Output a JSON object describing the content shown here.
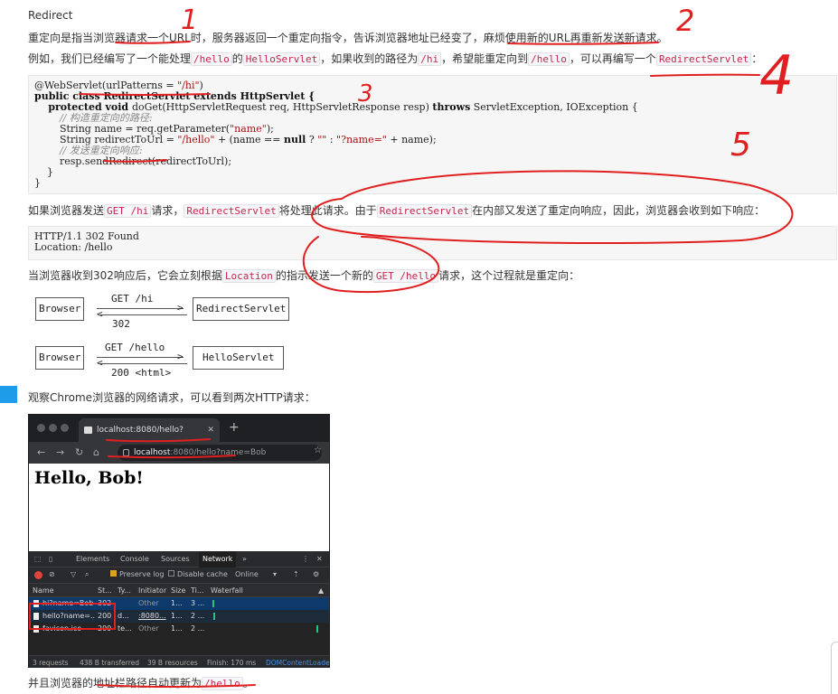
{
  "title": "Redirect",
  "intro": "重定向是指当浏览器请求一个URL时，服务器返回一个重定向指令，告诉浏览器地址已经变了，麻烦使用新的URL再重新发送新请求。",
  "example": {
    "t1": "例如，我们已经编写了一个能处理",
    "c1": "/hello",
    "t2": "的",
    "c2": "HelloServlet",
    "t3": "，如果收到的路径为",
    "c3": "/hi",
    "t4": "，希望能重定向到",
    "c4": "/hello",
    "t5": "，可以再编写一个",
    "c5": "RedirectServlet",
    "t6": "："
  },
  "code": {
    "l1a": "@WebServlet(urlPatterns = ",
    "l1b": "\"/hi\"",
    "l1c": ")",
    "l2a": "public class ",
    "l2b": "RedirectServlet",
    "l2c": " extends ",
    "l2d": "HttpServlet",
    "l2e": " {",
    "l3a": "    protected void ",
    "l3b": "doGet(HttpServletRequest req, HttpServletResponse resp) ",
    "l3c": "throws",
    "l3d": " ServletException, IOException {",
    "l4": "        // 构造重定向的路径:",
    "l5a": "        String name = req.getParameter(",
    "l5b": "\"name\"",
    "l5c": ");",
    "l6a": "        String redirectToUrl = ",
    "l6b": "\"/hello\"",
    "l6c": " + (name == ",
    "l6d": "null",
    "l6e": " ? ",
    "l6f": "\"\"",
    "l6g": " : ",
    "l6h": "\"?name=\"",
    "l6i": " + name);",
    "l7": "        // 发送重定向响应:",
    "l8": "        resp.sendRedirect(redirectToUrl);",
    "l9": "    }",
    "l10": "}"
  },
  "para2": {
    "t1": "如果浏览器发送",
    "c1": "GET /hi",
    "t2": "请求，",
    "c2": "RedirectServlet",
    "t3": "将处理此请求。由于",
    "c3": "RedirectServlet",
    "t4": "在内部又发送了重定向响应，因此，浏览器会收到如下响应："
  },
  "response": {
    "l1": "HTTP/1.1 302 Found",
    "l2": "Location: /hello"
  },
  "para3": {
    "t1": "当浏览器收到302响应后，它会立刻根据",
    "c1": "Location",
    "t2": "的指示发送一个新的",
    "c2": "GET /hello",
    "t3": "请求，这个过程就是重定向："
  },
  "diagram1": {
    "left": "Browser",
    "req": "GET /hi",
    "resp": "302",
    "right": "RedirectServlet"
  },
  "diagram2": {
    "left": "Browser",
    "req": "GET /hello",
    "resp": "200 <html>",
    "right": "HelloServlet"
  },
  "para4": "观察Chrome浏览器的网络请求，可以看到两次HTTP请求：",
  "chrome": {
    "tab_title": "localhost:8080/hello?name=Bob",
    "tab_close": "✕",
    "new_tab": "+",
    "url_host": "localhost",
    "url_path": ":8080/hello?name=Bob",
    "page_heading": "Hello, Bob!",
    "devtools": {
      "tabs": [
        "Elements",
        "Console",
        "Sources",
        "Network"
      ],
      "more": "»",
      "preserve_log": "Preserve log",
      "disable_cache": "Disable cache",
      "throttle": "Online",
      "columns": [
        "Name",
        "St...",
        "Ty...",
        "Initiator",
        "Size",
        "Ti...",
        "Waterfall"
      ],
      "rows": [
        {
          "name": "hi?name=Bob",
          "status": "302",
          "type": "",
          "initiator": "Other",
          "size": "1...",
          "time": "3 ..."
        },
        {
          "name": "hello?name=...",
          "status": "200",
          "type": "d...",
          "initiator": ":8080...",
          "size": "1...",
          "time": "2 ..."
        },
        {
          "name": "favicon.ico",
          "status": "200",
          "type": "te...",
          "initiator": "Other",
          "size": "1...",
          "time": "2 ..."
        }
      ],
      "status_bar": {
        "requests": "3 requests",
        "transferred": "438 B transferred",
        "resources": "39 B resources",
        "finish": "Finish: 170 ms",
        "dcl": "DOMContentLoade"
      }
    }
  },
  "para5": {
    "t1": "并且浏览器的地址栏路径自动更新为",
    "c1": "/hello",
    "t2": "。"
  },
  "annotations": {
    "n1": "1",
    "n2": "2",
    "n3": "3",
    "n4": "4",
    "n5": "5"
  },
  "colors": {
    "annotation_red": "#e02020",
    "link_blue": "#1e9be9",
    "code_red": "#c7254e"
  }
}
